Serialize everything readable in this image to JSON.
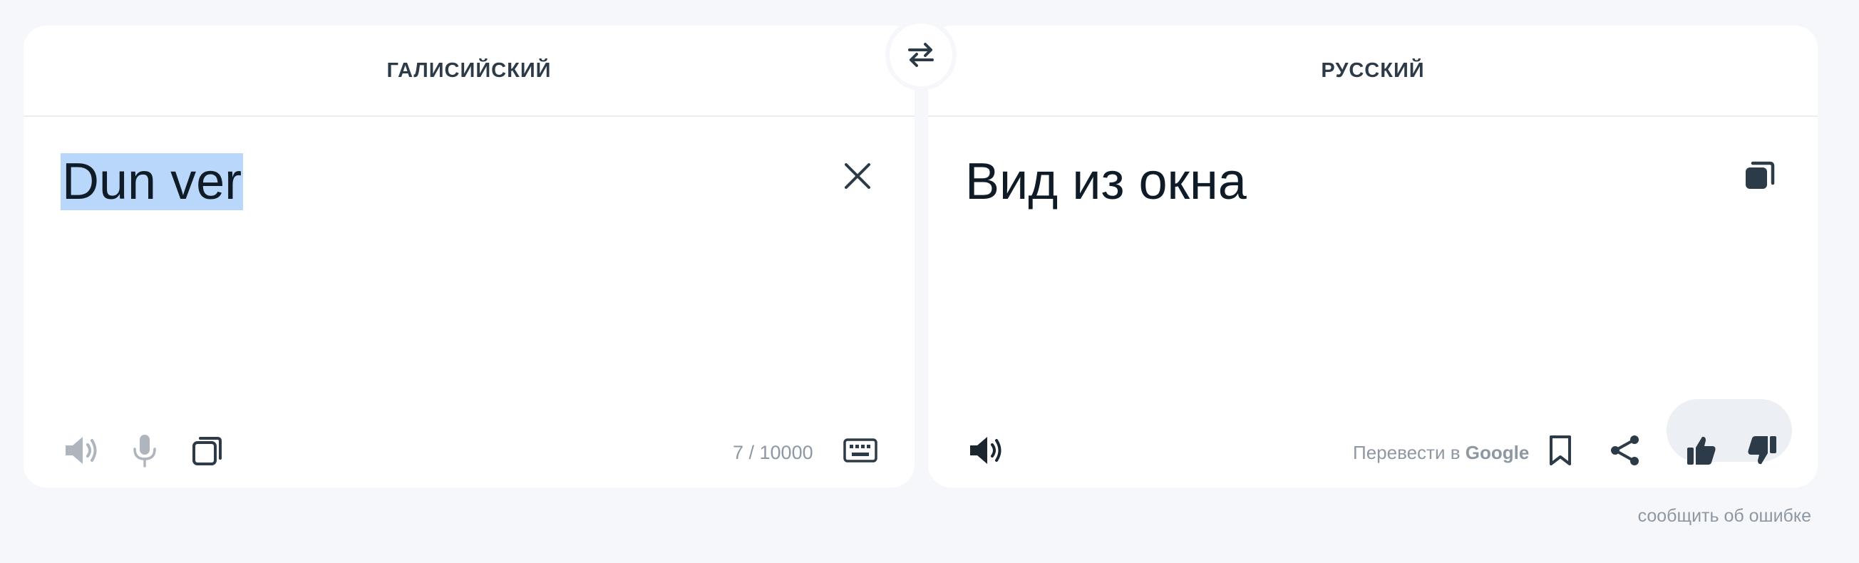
{
  "source": {
    "language": "ГАЛИСИЙСКИЙ",
    "text": "Dun ver",
    "counter": "7 / 10000",
    "icons": [
      "close-icon",
      "speaker-icon",
      "microphone-icon",
      "copy-icon",
      "keyboard-icon"
    ]
  },
  "target": {
    "language": "РУССКИЙ",
    "text": "Вид из окна",
    "google_prefix": "Перевести в ",
    "google_brand": "Google",
    "icons": [
      "copy-icon",
      "speaker-icon",
      "bookmark-icon",
      "share-icon",
      "thumbs-up-icon",
      "thumbs-down-icon"
    ]
  },
  "swap": {
    "icon": "swap-arrows-icon"
  },
  "footer": {
    "report_label": "сообщить об ошибке"
  },
  "colors": {
    "background": "#f6f7fa",
    "panel": "#ffffff",
    "selection": "#b9d7fb",
    "icon_dark": "#2d3a47",
    "icon_muted": "#aeb5bd",
    "muted_text": "#8e98a3",
    "rate_pill": "#eceff4"
  }
}
